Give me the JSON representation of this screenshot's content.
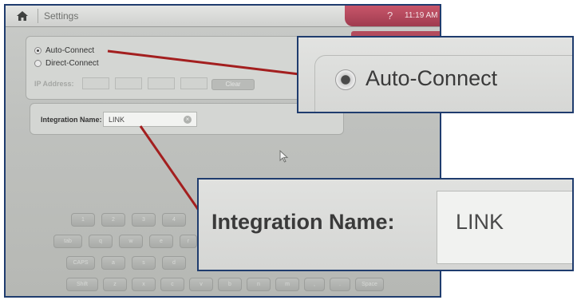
{
  "titlebar": {
    "title": "Settings",
    "help": "?",
    "time": "11:19 AM",
    "accent_color": "#a8465a"
  },
  "connection": {
    "options": [
      {
        "label": "Auto-Connect",
        "selected": true
      },
      {
        "label": "Direct-Connect",
        "selected": false
      }
    ],
    "ip_label": "IP Address:",
    "clear_label": "Clear"
  },
  "integration": {
    "label": "Integration Name:",
    "value": "LINK",
    "clear_icon": "clear-circle-icon"
  },
  "keyboard": {
    "row1": [
      "1",
      "2",
      "3",
      "4"
    ],
    "row2": [
      "tab",
      "q",
      "w",
      "e",
      "r"
    ],
    "row3": [
      "CAPS",
      "a",
      "s",
      "d"
    ],
    "row4": [
      "Shift",
      "z",
      "x",
      "c",
      "v",
      "b",
      "n",
      "m",
      ",",
      ".",
      "Space"
    ]
  },
  "zoom": {
    "radio_label": "Auto-Connect",
    "integration_label": "Integration Name:",
    "integration_value": "LINK",
    "callout_line_color": "#a31f1f",
    "border_color": "#1f3c6e"
  }
}
